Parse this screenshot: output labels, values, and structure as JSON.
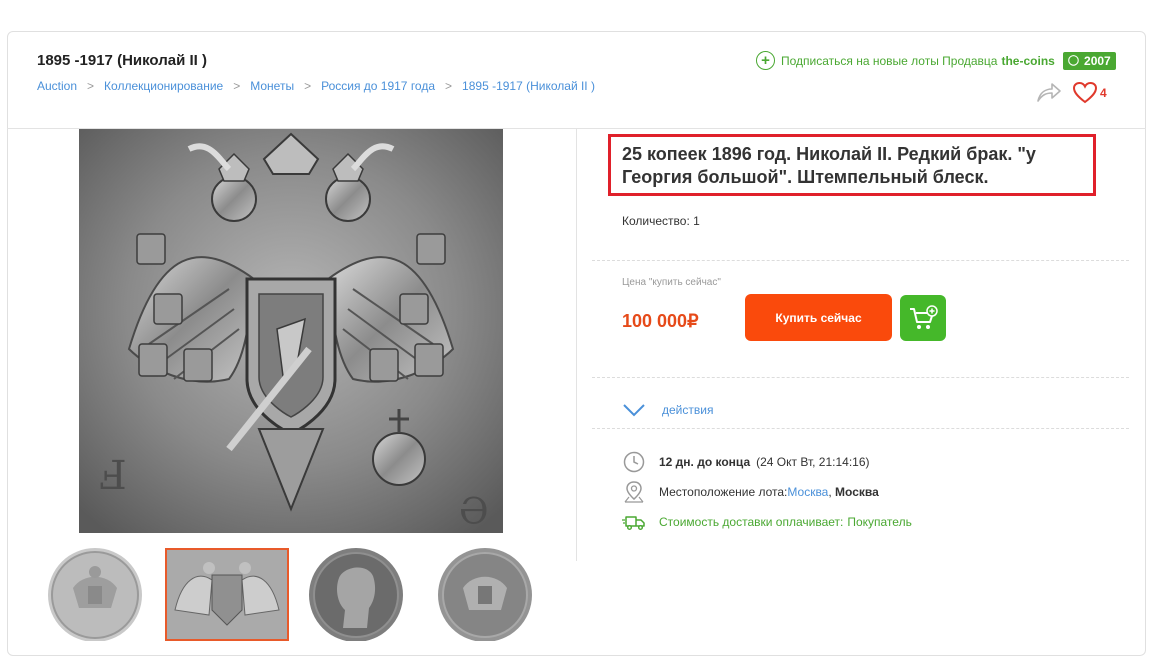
{
  "header": {
    "category_title": "1895 -1917 (Николай II )",
    "breadcrumbs": [
      {
        "label": "Auction"
      },
      {
        "label": "Коллекционирование"
      },
      {
        "label": "Монеты"
      },
      {
        "label": "Россия до 1917 года"
      },
      {
        "label": "1895 -1917 (Николай II )"
      }
    ],
    "crumb_separator": ">",
    "subscribe_text": "Подписаться на новые лоты Продавца",
    "seller_name": "the-coins",
    "seller_rating": "2007",
    "likes_count": "4"
  },
  "gallery": {
    "thumbnails": [
      {
        "name": "thumb-coin-reverse",
        "selected": false
      },
      {
        "name": "thumb-coin-eagle-closeup",
        "selected": true
      },
      {
        "name": "thumb-coin-portrait",
        "selected": false
      },
      {
        "name": "thumb-coin-reverse-2",
        "selected": false
      }
    ]
  },
  "lot": {
    "title": "25 копеек 1896 год. Николай II. Редкий брак. \"у Георгия большой\". Штемпельный блеск.",
    "quantity": "Количество: 1",
    "price_label": "Цена \"купить сейчас\"",
    "price": "100 000₽",
    "buy_button": "Купить сейчас",
    "actions_label": "действия",
    "time_left": "12 дн. до конца",
    "end_date": "(24 Окт Вт, 21:14:16)",
    "location_label": "Местоположение лота:",
    "location_city_link": "Москва",
    "location_city": "Москва",
    "shipping_text": "Стоимость доставки оплачивает:",
    "shipping_payer": "Покупатель"
  },
  "colors": {
    "accent_blue": "#4a90d9",
    "green": "#4aa832",
    "buy_orange": "#fa4a0c",
    "price_red": "#e64a19",
    "highlight_red": "#e0202a"
  },
  "icons": [
    "plus-circle-icon",
    "person-icon",
    "share-icon",
    "heart-icon",
    "cart-plus-icon",
    "chevron-down-icon",
    "clock-icon",
    "location-pin-icon",
    "delivery-truck-icon"
  ]
}
